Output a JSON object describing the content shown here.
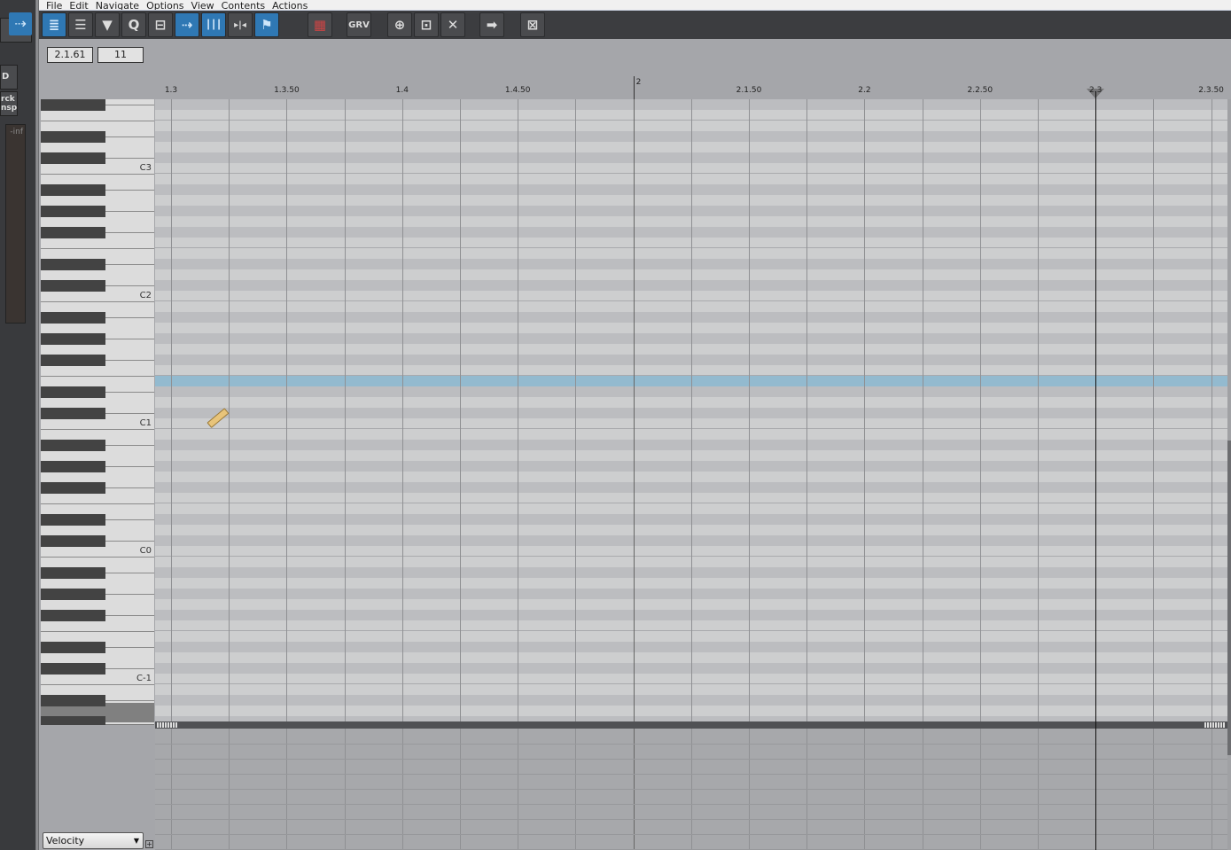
{
  "menu": [
    "File",
    "Edit",
    "Navigate",
    "Options",
    "View",
    "Contents",
    "Actions"
  ],
  "toolbar": [
    {
      "name": "event-list",
      "icon": "≣",
      "active": true
    },
    {
      "name": "track-list",
      "icon": "☰",
      "active": false
    },
    {
      "name": "filter",
      "icon": "▼",
      "active": false
    },
    {
      "name": "quantize",
      "icon": "Q",
      "active": false
    },
    {
      "name": "snap",
      "icon": "⊟",
      "active": false
    },
    {
      "name": "select-tool",
      "icon": "⇢",
      "active": true
    },
    {
      "name": "grid-lines",
      "icon": "┃┃┃",
      "active": true
    },
    {
      "name": "split",
      "icon": "▸|◂",
      "active": false
    },
    {
      "name": "follow-playback",
      "icon": "⚑",
      "active": true
    },
    {
      "name": "midi-keyboard",
      "icon": "▦",
      "active": false
    },
    {
      "name": "groove",
      "icon": "GRV",
      "active": false
    },
    {
      "name": "loop-zoom",
      "icon": "⊕",
      "active": false
    },
    {
      "name": "zoom-selection",
      "icon": "⊡",
      "active": false
    },
    {
      "name": "zoom-fit",
      "icon": "✕",
      "active": false
    },
    {
      "name": "go-to-end",
      "icon": "➡",
      "active": false
    },
    {
      "name": "close",
      "icon": "⊠",
      "active": false
    }
  ],
  "left_panel": {
    "button1": "D",
    "button2": "rck\nnsp",
    "meter": "-inf"
  },
  "position_field": "2.1.61",
  "value_field": "11",
  "ruler": [
    "1.3",
    "1.3.50",
    "1.4",
    "1.4.50",
    "2",
    "2.1.50",
    "2.2",
    "2.2.50",
    "2.3",
    "2.3.50"
  ],
  "playhead": "2.3",
  "key_labels": [
    "C3",
    "C2",
    "C1",
    "C0",
    "C-1"
  ],
  "top_note": "F#3",
  "highlighted_note": "E1",
  "lane_select": "Velocity",
  "colors": {
    "highlight_row": "#93bacf",
    "active_button": "#2f78b4"
  }
}
